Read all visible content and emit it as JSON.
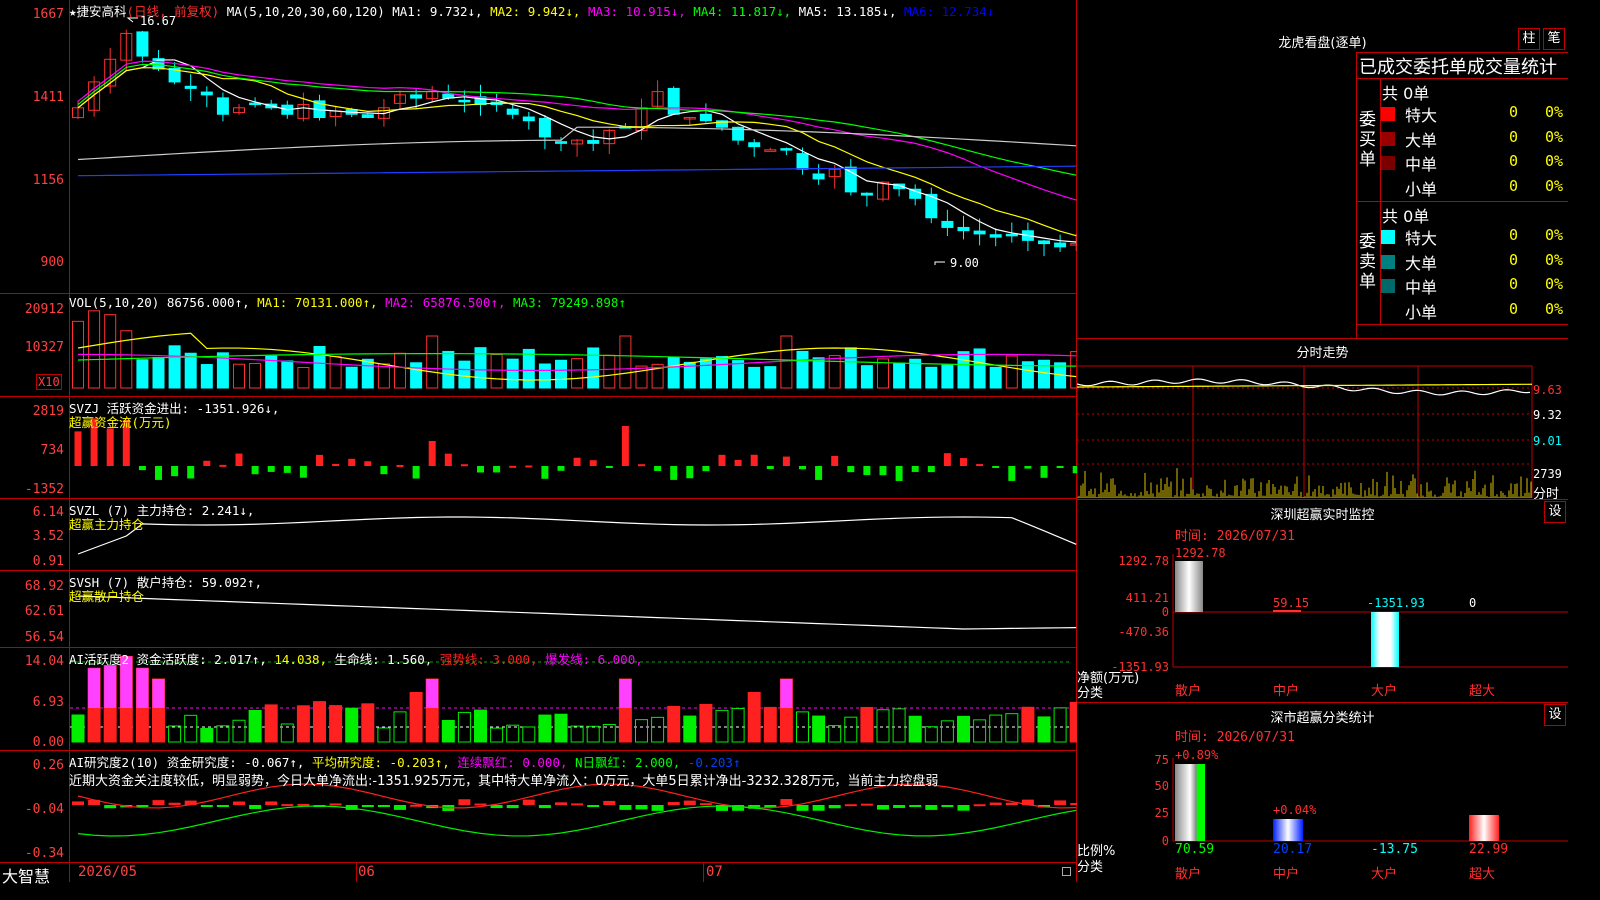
{
  "stock": {
    "star": "★",
    "name": "捷安高科",
    "period": "(日线, 前复权)",
    "high_mark": "16.67",
    "low_mark": "9.00"
  },
  "ma_line": [
    {
      "label": "MA(5,10,20,30,60,120)",
      "color": "#ffffff"
    },
    {
      "label": "MA1: 9.732↓,",
      "color": "#ffffff"
    },
    {
      "label": "MA2: 9.942↓,",
      "color": "#ffff00"
    },
    {
      "label": "MA3: 10.915↓,",
      "color": "#ff00ff"
    },
    {
      "label": "MA4: 11.817↓,",
      "color": "#00ff00"
    },
    {
      "label": "MA5: 13.185↓,",
      "color": "#ffffff"
    },
    {
      "label": "MA6: 12.734↓",
      "color": "#0000ff"
    }
  ],
  "price_axis": [
    "1667",
    "1411",
    "1156",
    "900"
  ],
  "vol_line": [
    {
      "label": "VOL(5,10,20)",
      "color": "#ffffff"
    },
    {
      "label": "86756.000↑,",
      "color": "#ffffff"
    },
    {
      "label": "MA1: 70131.000↑,",
      "color": "#ffff00"
    },
    {
      "label": "MA2: 65876.500↑,",
      "color": "#ff00ff"
    },
    {
      "label": "MA3: 79249.898↑",
      "color": "#00ff00"
    }
  ],
  "vol_axis": [
    "20912",
    "10327"
  ],
  "vol_unit": "X10",
  "svzj": {
    "title": "SVZJ  活跃资金进出: -1351.926↓,",
    "sub": "超赢资金流(万元)",
    "axis": [
      "2819",
      "734",
      "-1352"
    ]
  },
  "svzl": {
    "title": "SVZL (7) 主力持仓: 2.241↓,",
    "sub": "超赢主力持仓",
    "axis": [
      "6.14",
      "3.52",
      "0.91"
    ]
  },
  "svsh": {
    "title": "SVSH (7) 散户持仓: 59.092↑,",
    "sub": "超赢散户持仓",
    "axis": [
      "68.92",
      "62.61",
      "56.54"
    ]
  },
  "ai1": {
    "parts": [
      {
        "t": "AI活跃度2 资金活跃度: 2.017↑,",
        "c": "#ffffff"
      },
      {
        "t": "14.038,",
        "c": "#ffff00"
      },
      {
        "t": "生命线: 1.560,",
        "c": "#ffffff"
      },
      {
        "t": "强势线: 3.000,",
        "c": "#ff2020"
      },
      {
        "t": "爆发线: 6.000,",
        "c": "#ff00ff"
      }
    ],
    "axis": [
      "14.04",
      "6.93",
      "0.00"
    ]
  },
  "ai2": {
    "parts": [
      {
        "t": "AI研究度2(10) 资金研究度: -0.067↑,",
        "c": "#ffffff"
      },
      {
        "t": "平均研究度: -0.203↑,",
        "c": "#ffff00"
      },
      {
        "t": "连续飘红: 0.000,",
        "c": "#ff00ff"
      },
      {
        "t": "N日飘红: 2.000,",
        "c": "#00ff00"
      },
      {
        "t": "-0.203↑",
        "c": "#0040ff"
      }
    ],
    "note": "近期大资金关注度较低，明显弱势，今日大单净流出:-1351.925万元，其中特大单净流入：0万元，大单5日累计净出-3232.328万元，当前主力控盘弱",
    "axis": [
      "0.26",
      "-0.04",
      "-0.34"
    ]
  },
  "date_axis": [
    "2026/05",
    "06",
    "07"
  ],
  "brand": "大智慧",
  "side": {
    "title": "龙虎看盘(逐单)",
    "btn_bar": "柱",
    "btn_stroke": "笔",
    "tabs": "已成交委托单成交量统计",
    "buy": {
      "head": "共 0单",
      "side_label": "委买单",
      "rows": [
        {
          "name": "特大",
          "v": "0",
          "p": "0%",
          "c": "#ff0000"
        },
        {
          "name": "大单",
          "v": "0",
          "p": "0%",
          "c": "#9a0000"
        },
        {
          "name": "中单",
          "v": "0",
          "p": "0%",
          "c": "#7a0000"
        },
        {
          "name": "小单",
          "v": "0",
          "p": "0%",
          "c": "#000000"
        }
      ]
    },
    "sell": {
      "head": "共 0单",
      "side_label": "委卖单",
      "rows": [
        {
          "name": "特大",
          "v": "0",
          "p": "0%",
          "c": "#00ffff"
        },
        {
          "name": "大单",
          "v": "0",
          "p": "0%",
          "c": "#008080"
        },
        {
          "name": "中单",
          "v": "0",
          "p": "0%",
          "c": "#006a6a"
        },
        {
          "name": "小单",
          "v": "0",
          "p": "0%",
          "c": "#000000"
        }
      ]
    },
    "intraday": {
      "title": "分时走势",
      "axis": [
        "9.63",
        "9.32",
        "9.01"
      ],
      "vol_axis": "2739",
      "vol_label": "分时"
    },
    "sz_monitor": {
      "title": "深圳超赢实时监控",
      "set": "设",
      "time": "时间: 2026/07/31",
      "axis": [
        "1292.78",
        "411.21",
        "0",
        "-470.36",
        "-1351.93"
      ],
      "ylab": "净额(万元)",
      "xlab": "分类",
      "values": [
        {
          "cat": "散户",
          "v": "1292.78",
          "vc": "#ff3030"
        },
        {
          "cat": "中户",
          "v": "59.15",
          "vc": "#ff3030"
        },
        {
          "cat": "大户",
          "v": "-1351.93",
          "vc": "#00ffff"
        },
        {
          "cat": "超大",
          "v": "0",
          "vc": "#ffffff"
        }
      ]
    },
    "sz_class": {
      "title": "深市超赢分类统计",
      "set": "设",
      "time": "时间: 2026/07/31",
      "axis": [
        "75",
        "50",
        "25",
        "0"
      ],
      "ylab": "比例%",
      "xlab": "分类",
      "top_labels": [
        "+0.89%",
        "+0.04%"
      ],
      "values": [
        {
          "cat": "散户",
          "v": "70.59",
          "vc": "#00ff00"
        },
        {
          "cat": "中户",
          "v": "20.17",
          "vc": "#0040ff"
        },
        {
          "cat": "大户",
          "v": "-13.75",
          "vc": "#00ffff"
        },
        {
          "cat": "超大",
          "v": "22.99",
          "vc": "#ff3030"
        }
      ]
    }
  }
}
